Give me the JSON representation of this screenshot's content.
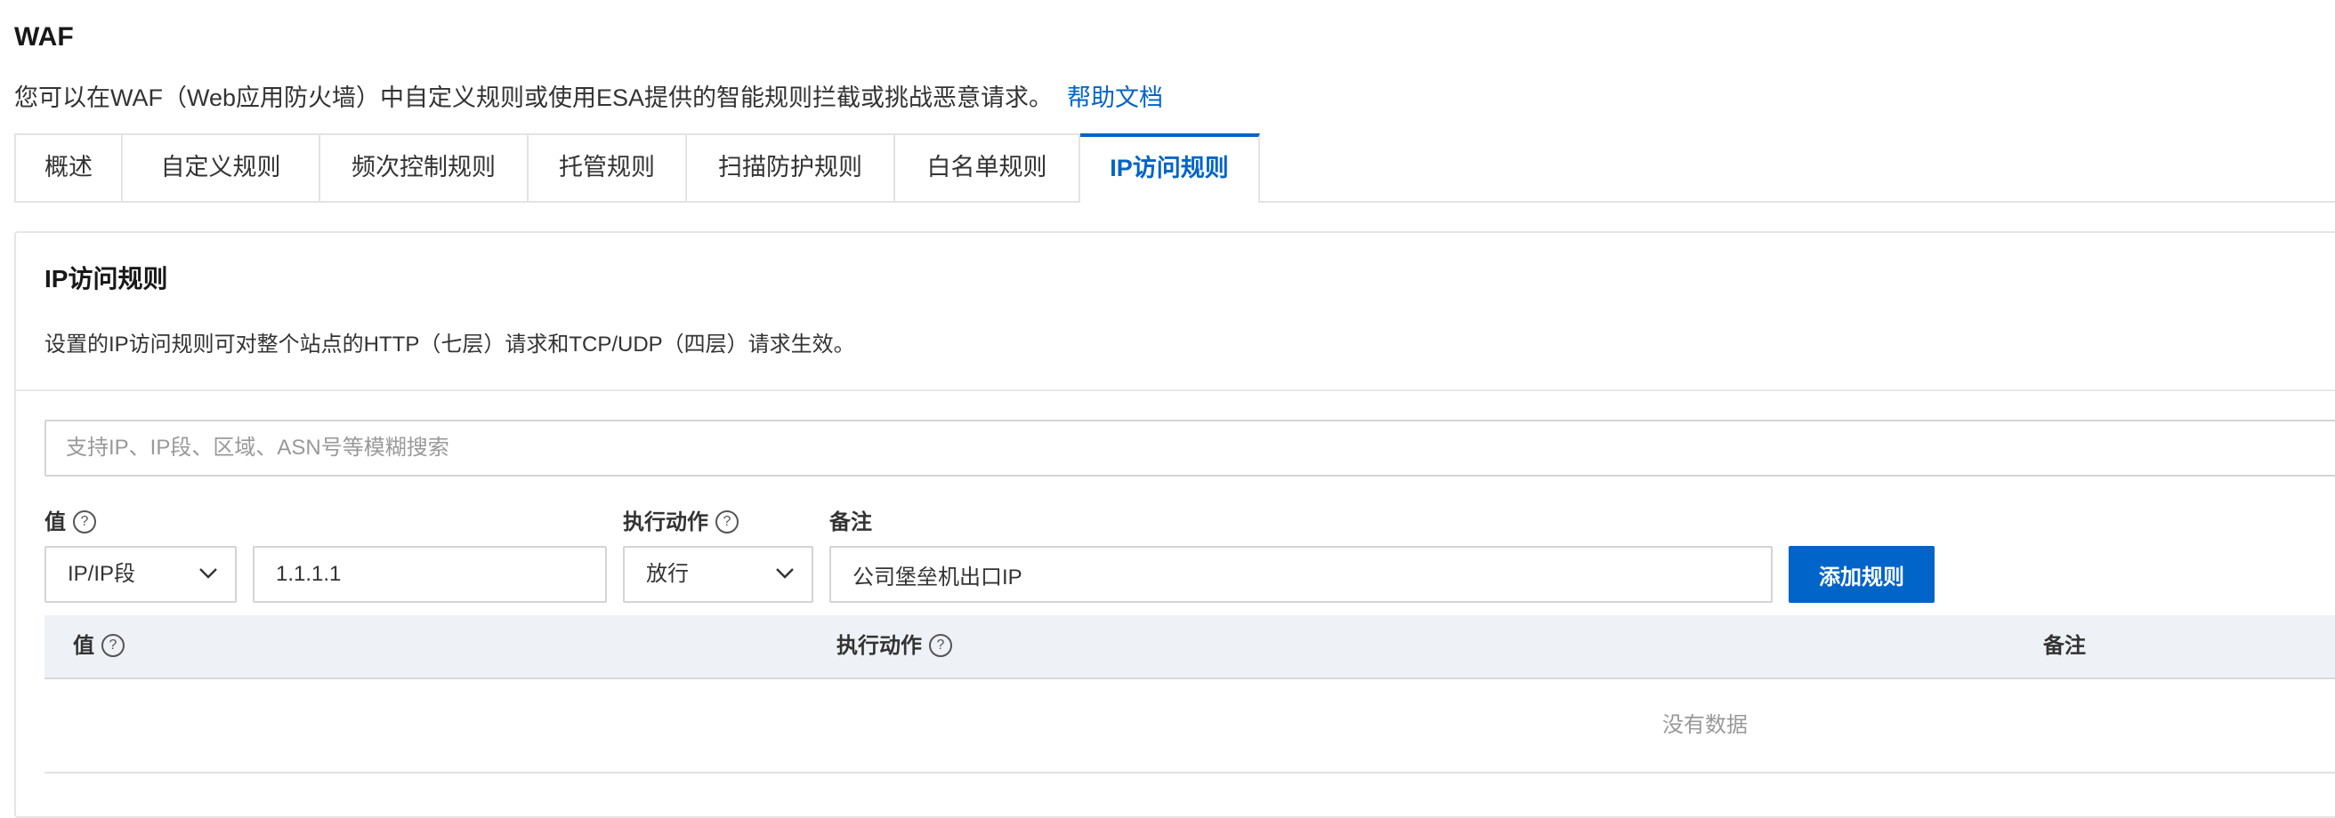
{
  "header": {
    "title": "WAF",
    "description": "您可以在WAF（Web应用防火墙）中自定义规则或使用ESA提供的智能规则拦截或挑战恶意请求。",
    "help_link": "帮助文档"
  },
  "tabs": [
    {
      "label": "概述",
      "active": false
    },
    {
      "label": "自定义规则",
      "active": false
    },
    {
      "label": "频次控制规则",
      "active": false
    },
    {
      "label": "托管规则",
      "active": false
    },
    {
      "label": "扫描防护规则",
      "active": false
    },
    {
      "label": "白名单规则",
      "active": false
    },
    {
      "label": "IP访问规则",
      "active": true
    }
  ],
  "card": {
    "title": "IP访问规则",
    "description": "设置的IP访问规则可对整个站点的HTTP（七层）请求和TCP/UDP（四层）请求生效。",
    "search": {
      "placeholder": "支持IP、IP段、区域、ASN号等模糊搜索",
      "value": ""
    },
    "form": {
      "value_label": "值",
      "action_label": "执行动作",
      "note_label": "备注",
      "type_select": "IP/IP段",
      "value_input": "1.1.1.1",
      "action_select": "放行",
      "note_input": "公司堡垒机出口IP",
      "add_button": "添加规则"
    },
    "table": {
      "columns": [
        "值",
        "执行动作",
        "备注"
      ],
      "rows": [],
      "empty_text": "没有数据"
    }
  },
  "colors": {
    "accent": "#0064c8",
    "table_header_bg": "#eef1f5",
    "border": "#d4d4d4"
  },
  "icons": {
    "help": "question-circle-icon",
    "dropdown": "chevron-down-icon"
  }
}
